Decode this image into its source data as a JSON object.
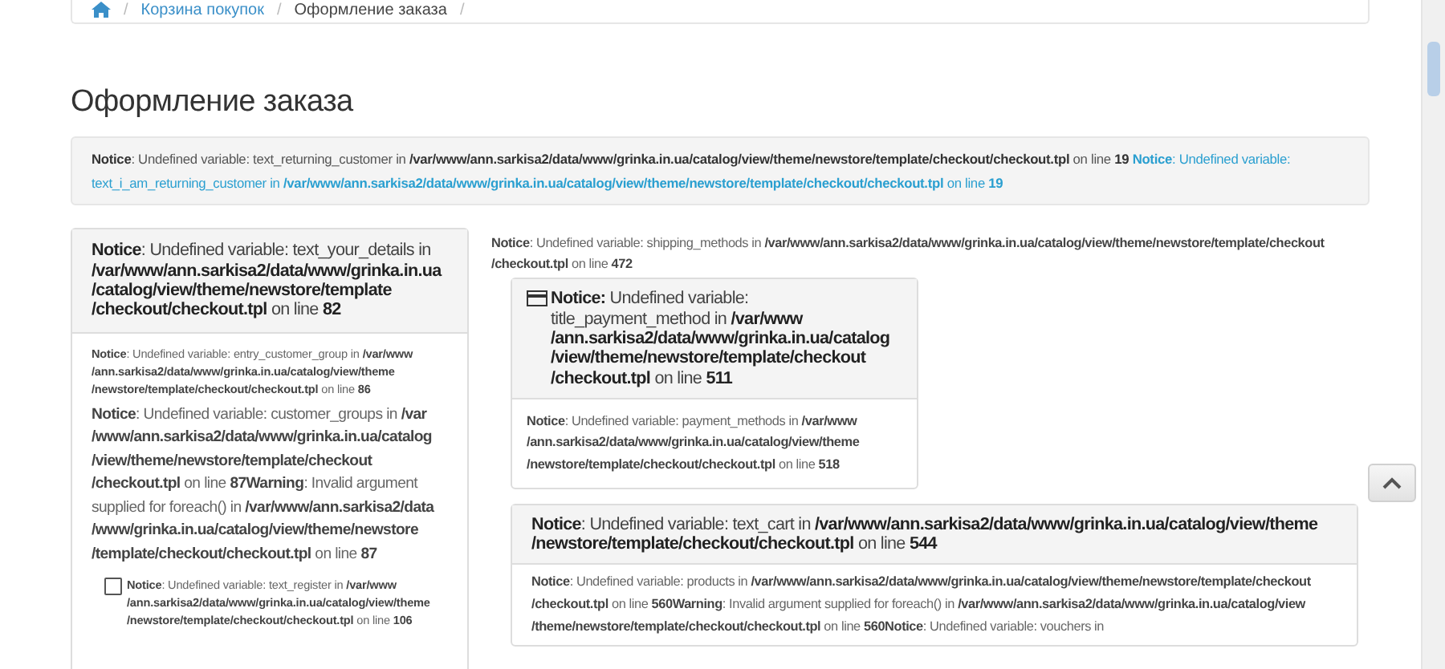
{
  "breadcrumb": [
    {
      "kind": "home",
      "separator": "/"
    },
    {
      "kind": "link",
      "text": "Корзина покупок",
      "separator": "/"
    },
    {
      "kind": "current",
      "text": "Оформление заказа",
      "separator": "/"
    }
  ],
  "title": "Оформление заказа",
  "alert": {
    "notices": [
      {
        "kind": "plain",
        "text": "**Notice**: Undefined variable: text_returning_customer in **/var/www/ann.sarkisa2/data/www/grinka.in.ua/catalog/view/theme/newstore/template/checkout/checkout.tpl** on line **19**"
      },
      {
        "kind": "info",
        "text": "**Notice**: Undefined variable: text_i_am_returning_customer in **/var/www/ann.sarkisa2/data/www/grinka.in.ua/catalog/view/theme/newstore/template/checkout/checkout.tpl** on line **19**"
      }
    ]
  },
  "details_panel": {
    "heading": "**Notice**: Undefined variable: text_your_details in **/var/www/ann.sarkisa2/data/www/grinka.in.ua/catalog/view/theme/newstore/template/checkout/checkout.tpl** on line **82**",
    "body": [
      {
        "kind": "small",
        "text": "**Notice**: Undefined variable: entry_customer_group in **/var/www/ann.sarkisa2/data/www/grinka.in.ua/catalog/view/theme/newstore/template/checkout/checkout.tpl** on line **86**"
      },
      {
        "kind": "normal",
        "text": "**Notice**: Undefined variable: customer_groups in **/var/www/ann.sarkisa2/data/www/grinka.in.ua/catalog/view/theme/newstore/template/checkout/checkout.tpl** on line **87Warning**: Invalid argument supplied for foreach() in **/var/www/ann.sarkisa2/data/www/grinka.in.ua/catalog/view/theme/newstore/template/checkout/checkout.tpl** on line **87**"
      }
    ],
    "checkbox": {
      "checked": false,
      "text": "**Notice**: Undefined variable: text_register in **/var/www/ann.sarkisa2/data/www/grinka.in.ua/catalog/view/theme/newstore/template/checkout/checkout.tpl** on line **106**"
    }
  },
  "shipping_notice": "**Notice**: Undefined variable: shipping_methods in **/var/www/ann.sarkisa2/data/www/grinka.in.ua/catalog/view/theme/newstore/template/checkout/checkout.tpl** on line **472**",
  "payment_panel": {
    "heading": "**Notice:** Undefined variable: title_payment_method in **/var/www/ann.sarkisa2/data/www/grinka.in.ua/catalog/view/theme/newstore/template/checkout/checkout.tpl** on line **511**",
    "body": "**Notice**: Undefined variable: payment_methods in **/var/www/ann.sarkisa2/data/www/grinka.in.ua/catalog/view/theme/newstore/template/checkout/checkout.tpl** on line **518**"
  },
  "cart_panel": {
    "heading": "**Notice**: Undefined variable: text_cart in **/var/www/ann.sarkisa2/data/www/grinka.in.ua/catalog/view/theme/newstore/template/checkout/checkout.tpl** on line **544**",
    "body": "**Notice**: Undefined variable: products in **/var/www/ann.sarkisa2/data/www/grinka.in.ua/catalog/view/theme/newstore/template/checkout/checkout.tpl** on line **560Warning**: Invalid argument supplied for foreach() in **/var/www/ann.sarkisa2/data/www/grinka.in.ua/catalog/view/theme/newstore/template/checkout/checkout.tpl** on line **560Notice**: Undefined variable: vouchers in"
  }
}
